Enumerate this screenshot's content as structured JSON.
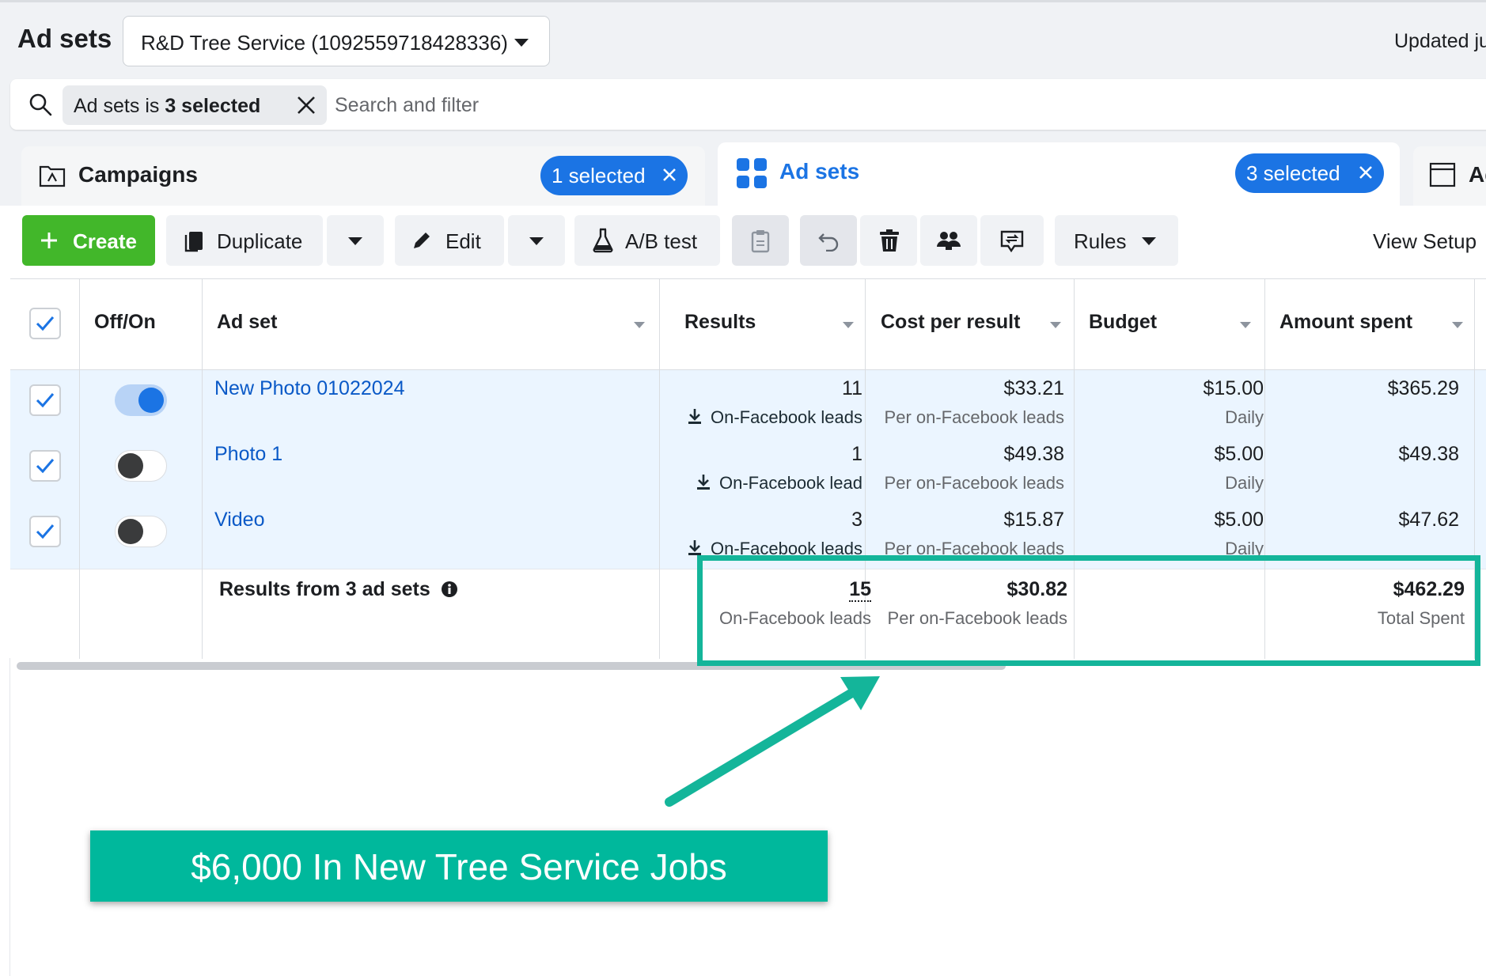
{
  "header": {
    "title": "Ad sets",
    "account": "R&D Tree Service (1092559718428336)",
    "updated": "Updated ju"
  },
  "search": {
    "filter_prefix": "Ad sets is ",
    "filter_value": "3 selected",
    "placeholder": "Search and filter"
  },
  "tabs": {
    "campaigns": {
      "label": "Campaigns",
      "selected": "1 selected"
    },
    "adsets": {
      "label": "Ad sets",
      "selected": "3 selected"
    },
    "ads": {
      "label": "Ad"
    }
  },
  "toolbar": {
    "create": "Create",
    "duplicate": "Duplicate",
    "edit": "Edit",
    "ab_test": "A/B test",
    "rules": "Rules",
    "view_setup": "View Setup"
  },
  "columns": {
    "offon": "Off/On",
    "adset": "Ad set",
    "results": "Results",
    "cost": "Cost per result",
    "budget": "Budget",
    "spent": "Amount spent"
  },
  "rows": [
    {
      "name": "New Photo 01022024",
      "on": true,
      "results": "11",
      "results_type": "On-Facebook leads",
      "cost": "$33.21",
      "cost_type": "Per on-Facebook leads",
      "budget": "$15.00",
      "budget_type": "Daily",
      "spent": "$365.29"
    },
    {
      "name": "Photo 1",
      "on": false,
      "results": "1",
      "results_type": "On-Facebook lead",
      "cost": "$49.38",
      "cost_type": "Per on-Facebook leads",
      "budget": "$5.00",
      "budget_type": "Daily",
      "spent": "$49.38"
    },
    {
      "name": "Video",
      "on": false,
      "results": "3",
      "results_type": "On-Facebook leads",
      "cost": "$15.87",
      "cost_type": "Per on-Facebook leads",
      "budget": "$5.00",
      "budget_type": "Daily",
      "spent": "$47.62"
    }
  ],
  "totals": {
    "label": "Results from 3 ad sets",
    "results": "15",
    "results_type": "On-Facebook leads",
    "cost": "$30.82",
    "cost_type": "Per on-Facebook leads",
    "spent": "$462.29",
    "spent_type": "Total Spent"
  },
  "annotation": {
    "banner": "$6,000 In New Tree Service Jobs",
    "accent": "#14b59a"
  },
  "colors": {
    "primary": "#1b74e4",
    "create_green": "#42b72a",
    "link": "#0a59c7"
  }
}
